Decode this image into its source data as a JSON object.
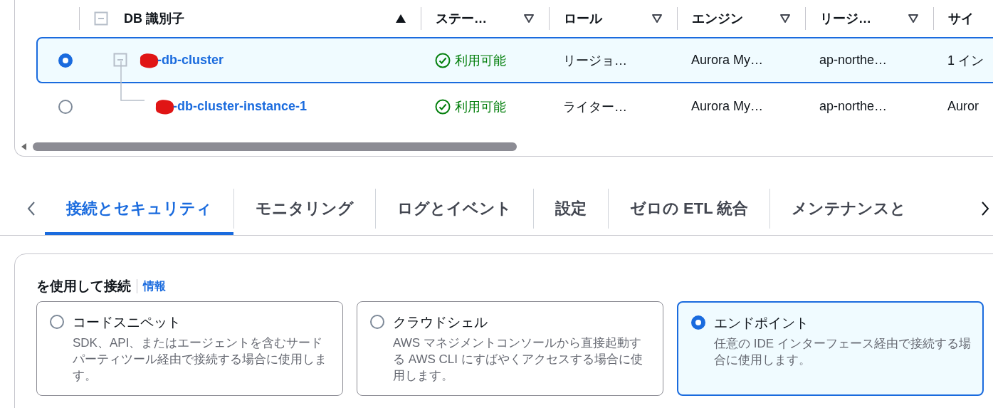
{
  "table": {
    "columns": [
      {
        "label": "DB 識別子",
        "sorted": true
      },
      {
        "label": "ステー…",
        "sorted": false
      },
      {
        "label": "ロール",
        "sorted": false
      },
      {
        "label": "エンジン",
        "sorted": false
      },
      {
        "label": "リージ…",
        "sorted": false
      },
      {
        "label": "サイ"
      }
    ],
    "rows": [
      {
        "identifier": "-db-cluster",
        "selected": true,
        "expanded": true,
        "status": "利用可能",
        "role": "リージョ…",
        "engine": "Aurora My…",
        "region": "ap-northe…",
        "size": "1 イン",
        "children": [
          {
            "identifier": "-db-cluster-instance-1",
            "selected": false,
            "status": "利用可能",
            "role": "ライター…",
            "engine": "Aurora My…",
            "region": "ap-northe…",
            "size": "Auror"
          }
        ]
      }
    ]
  },
  "tabs": [
    {
      "label": "接続とセキュリティ",
      "selected": true
    },
    {
      "label": "モニタリング",
      "selected": false
    },
    {
      "label": "ログとイベント",
      "selected": false
    },
    {
      "label": "設定",
      "selected": false
    },
    {
      "label": "ゼロの ETL 統合",
      "selected": false
    },
    {
      "label": "メンテナンスと",
      "selected": false
    }
  ],
  "connect": {
    "heading": "を使用して接続",
    "info_link": "情報",
    "options": [
      {
        "title": "コードスニペット",
        "description": "SDK、API、またはエージェントを含むサードパーティツール経由で接続する場合に使用します。",
        "selected": false
      },
      {
        "title": "クラウドシェル",
        "description": "AWS マネジメントコンソールから直接起動する AWS CLI にすばやくアクセスする場合に使用します。",
        "selected": false
      },
      {
        "title": "エンドポイント",
        "description": "任意の IDE インターフェース経由で接続する場合に使用します。",
        "selected": true
      }
    ]
  }
}
